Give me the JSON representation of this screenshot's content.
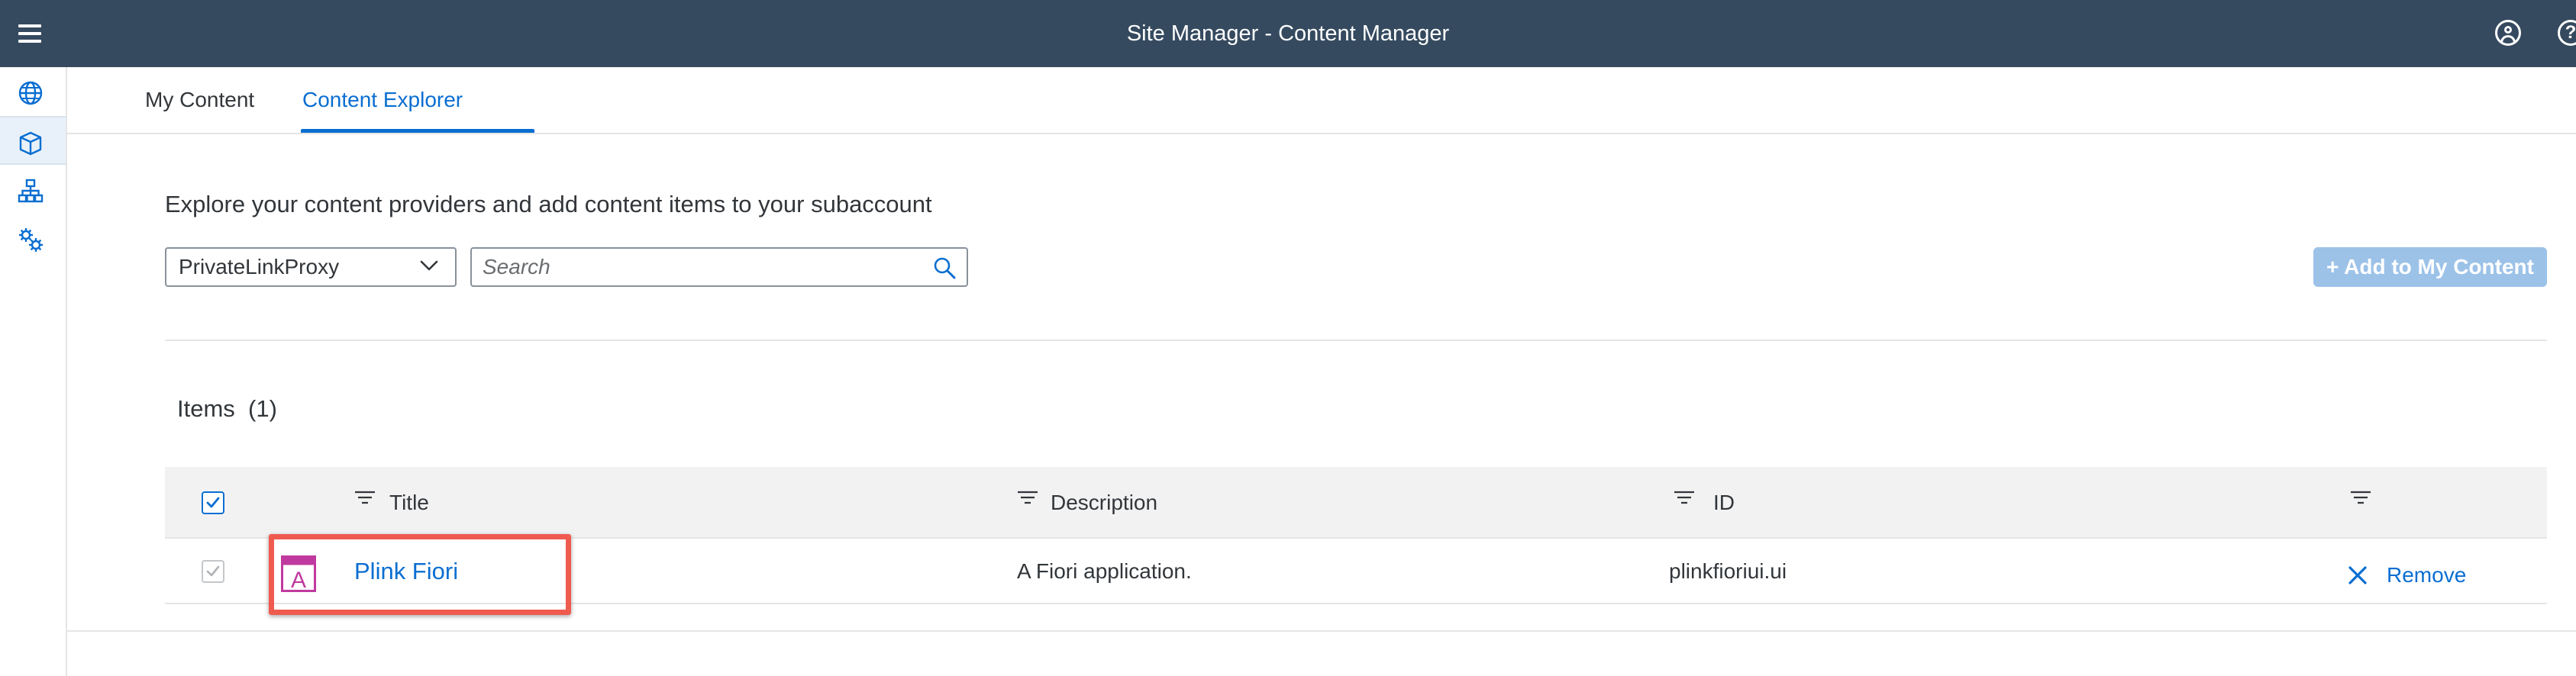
{
  "shell": {
    "title": "Site Manager - Content Manager",
    "menu_icon": "hamburger-menu-icon",
    "user_icon": "user-account-icon",
    "help_icon": "help-icon",
    "help_glyph": "?",
    "background_color": "#354a5f"
  },
  "sidenav": {
    "items": [
      {
        "icon": "globe-icon",
        "label": "Sites",
        "selected": false
      },
      {
        "icon": "cube-icon",
        "label": "Content Manager",
        "selected": true
      },
      {
        "icon": "hierarchy-icon",
        "label": "Channel Manager",
        "selected": false
      },
      {
        "icon": "settings-icon",
        "label": "Settings",
        "selected": false
      }
    ]
  },
  "tabs": [
    {
      "label": "My Content",
      "selected": false
    },
    {
      "label": "Content Explorer",
      "selected": true
    }
  ],
  "explorer": {
    "intro": "Explore your content providers and add content items to your subaccount",
    "provider_select": {
      "value": "PrivateLinkProxy"
    },
    "search": {
      "placeholder": "Search",
      "value": ""
    },
    "add_button": {
      "label": "+ Add to My Content",
      "enabled": false
    }
  },
  "items": {
    "title": "Items",
    "count": "(1)",
    "columns": [
      {
        "key": "title",
        "label": "Title"
      },
      {
        "key": "description",
        "label": "Description"
      },
      {
        "key": "id",
        "label": "ID"
      },
      {
        "key": "actions",
        "label": ""
      }
    ],
    "rows": [
      {
        "checked": true,
        "icon": "app-tile-icon",
        "icon_letter": "A",
        "title": "Plink Fiori",
        "description": "A Fiori application.",
        "id": "plinkfioriui.ui",
        "action": "Remove"
      }
    ]
  },
  "colors": {
    "accent": "#0a6ed1",
    "highlight_box": "#f05b4f",
    "app_icon": "#c0399f"
  }
}
